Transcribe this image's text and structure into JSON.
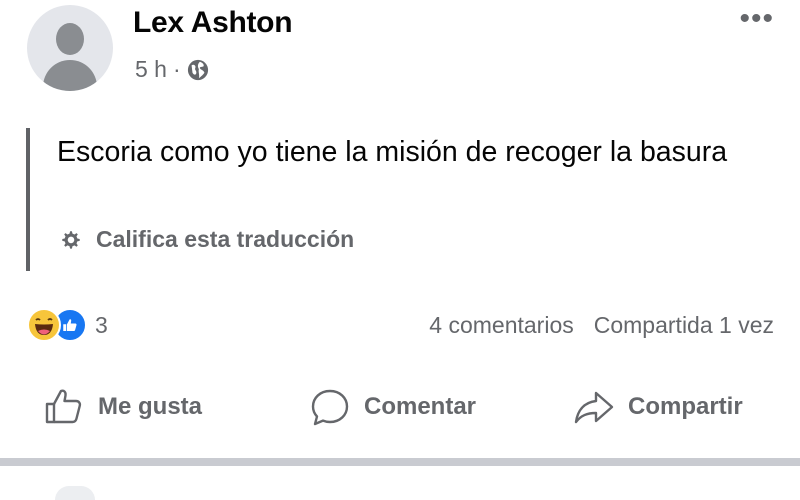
{
  "post": {
    "author": "Lex Ashton",
    "time": "5 h",
    "separator": "·",
    "visibility_icon": "globe-icon",
    "more_icon": "ellipsis-icon",
    "more_label": "•••",
    "text": "Escoria como yo tiene la misión de recoger la basura",
    "rate_translation": "Califica esta traducción",
    "rate_icon": "gear-icon"
  },
  "reactions": {
    "icons": [
      "haha-emoji",
      "like-emoji"
    ],
    "count": "3",
    "comments": "4 comentarios",
    "shares": "Compartida 1 vez"
  },
  "actions": {
    "like": "Me gusta",
    "comment": "Comentar",
    "share": "Compartir"
  },
  "colors": {
    "text": "#050505",
    "secondary": "#65676b",
    "like_blue": "#1877f2",
    "haha_yellow": "#f7c53b",
    "divider": "#c9cbd1"
  }
}
